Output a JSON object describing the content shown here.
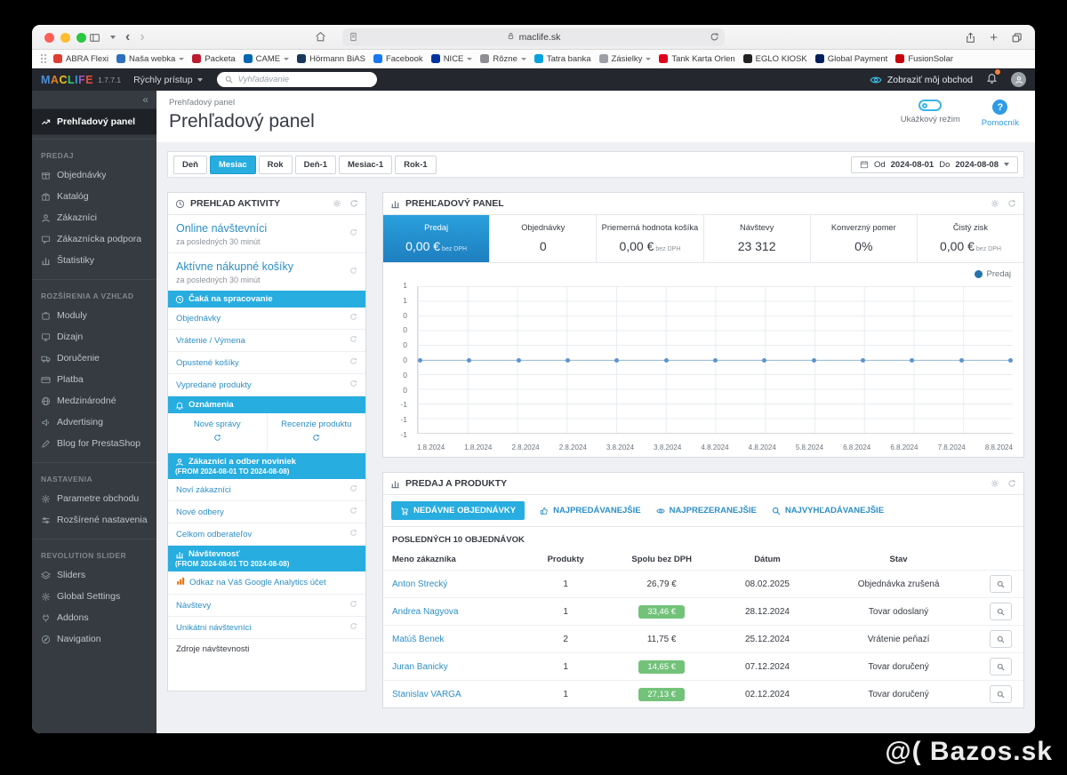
{
  "colors": {
    "accent": "#27ade0",
    "link": "#2d8fc6",
    "success": "#72c279",
    "kpi_active": "#1e7fc0",
    "sidebar_bg": "#363a41"
  },
  "browser": {
    "address": "maclife.sk",
    "bookmarks": [
      {
        "label": "ABRA Flexi"
      },
      {
        "label": "Naša webka"
      },
      {
        "label": "Packeta"
      },
      {
        "label": "CAME"
      },
      {
        "label": "Hörmann BiAS"
      },
      {
        "label": "Facebook"
      },
      {
        "label": "NICE"
      },
      {
        "label": "Rôzne"
      },
      {
        "label": "Tatra banka"
      },
      {
        "label": "Zásielky"
      },
      {
        "label": "Tank Karta Orlen"
      },
      {
        "label": "EGLO KIOSK"
      },
      {
        "label": "Global Payment"
      },
      {
        "label": "FusionSolar"
      }
    ]
  },
  "admin_bar": {
    "logo_letters": [
      {
        "ch": "M",
        "color": "#4a90d9"
      },
      {
        "ch": "A",
        "color": "#e67e22"
      },
      {
        "ch": "C",
        "color": "#f1c40f"
      },
      {
        "ch": "L",
        "color": "#2ecc71"
      },
      {
        "ch": "I",
        "color": "#3498db"
      },
      {
        "ch": "F",
        "color": "#9b59b6"
      },
      {
        "ch": "E",
        "color": "#e74c3c"
      }
    ],
    "version": "1.7.7.1",
    "quick_access": "Rýchly prístup",
    "search_placeholder": "Vyhľadávanie",
    "view_shop": "Zobraziť môj obchod"
  },
  "sidebar": {
    "collapse": "«",
    "active": "Prehľadový panel",
    "sections": [
      {
        "title": "PREDAJ",
        "items": [
          "Objednávky",
          "Katalóg",
          "Zákazníci",
          "Zákaznícka podpora",
          "Štatistiky"
        ]
      },
      {
        "title": "ROZŠÍRENIA A VZHĽAD",
        "items": [
          "Moduly",
          "Dizajn",
          "Doručenie",
          "Platba",
          "Medzinárodné",
          "Advertising",
          "Blog for PrestaShop"
        ]
      },
      {
        "title": "NASTAVENIA",
        "items": [
          "Parametre obchodu",
          "Rozšírené nastavenia"
        ]
      },
      {
        "title": "REVOLUTION SLIDER",
        "items": [
          "Sliders",
          "Global Settings",
          "Addons",
          "Navigation"
        ]
      }
    ]
  },
  "page": {
    "breadcrumb": "Prehľadový panel",
    "title": "Prehľadový panel",
    "demo_mode": "Ukážkový režim",
    "help": "Pomocník",
    "help_glyph": "?"
  },
  "toolbar": {
    "buttons": [
      "Deň",
      "Mesiac",
      "Rok",
      "Deň-1",
      "Mesiac-1",
      "Rok-1"
    ],
    "active": "Mesiac",
    "date_range": {
      "from_label": "Od",
      "from": "2024-08-01",
      "to_label": "Do",
      "to": "2024-08-08"
    }
  },
  "activity": {
    "title": "PREHĽAD AKTIVITY",
    "online": {
      "label": "Online návštevníci",
      "sub": "za posledných 30 minút"
    },
    "carts": {
      "label": "Aktívne nákupné košíky",
      "sub": "za posledných 30 minút"
    },
    "pending": {
      "title": "Čaká na spracovanie",
      "items": [
        "Objednávky",
        "Vrátenie / Výmena",
        "Opustené košíky",
        "Vypredané produkty"
      ]
    },
    "notifications": {
      "title": "Oznámenia",
      "cols": [
        "Nové správy",
        "Recenzie produktu"
      ]
    },
    "customers": {
      "title": "Zákazníci a odber noviniek",
      "range": "(FROM 2024-08-01 TO 2024-08-08)",
      "items": [
        "Noví zákazníci",
        "Nové odbery",
        "Celkom odberateľov"
      ]
    },
    "traffic": {
      "title": "Návštevnosť",
      "range": "(FROM 2024-08-01 TO 2024-08-08)",
      "ga_link": "Odkaz na Váš Google Analytics účet",
      "items": [
        "Návštevy",
        "Unikátni návštevníci"
      ],
      "footer": "Zdroje návštevnosti"
    }
  },
  "dashboard_panel": {
    "title": "PREHĽADOVÝ PANEL",
    "kpis": [
      {
        "label": "Predaj",
        "value": "0,00 €",
        "suffix": "bez DPH"
      },
      {
        "label": "Objednávky",
        "value": "0",
        "suffix": ""
      },
      {
        "label": "Priemerná hodnota košíka",
        "value": "0,00 €",
        "suffix": "bez DPH"
      },
      {
        "label": "Návštevy",
        "value": "23 312",
        "suffix": ""
      },
      {
        "label": "Konverzný pomer",
        "value": "0%",
        "suffix": ""
      },
      {
        "label": "Čistý zisk",
        "value": "0,00 €",
        "suffix": "bez DPH"
      }
    ],
    "legend": "Predaj"
  },
  "chart_data": {
    "type": "line",
    "title": "Predaj",
    "series": [
      {
        "name": "Predaj",
        "values": [
          0,
          0,
          0,
          0,
          0,
          0,
          0,
          0,
          0,
          0,
          0,
          0,
          0
        ]
      }
    ],
    "x_labels": [
      "1.8.2024",
      "1.8.2024",
      "2.8.2024",
      "2.8.2024",
      "3.8.2024",
      "3.8.2024",
      "4.8.2024",
      "4.8.2024",
      "5.8.2024",
      "6.8.2024",
      "6.8.2024",
      "7.8.2024",
      "8.8.2024"
    ],
    "ytick_labels": [
      "1",
      "1",
      "0",
      "0",
      "0",
      "0",
      "0",
      "0",
      "-1",
      "-1",
      "-1"
    ],
    "ylim": [
      -1,
      1
    ],
    "grid": true,
    "legend_position": "top-right"
  },
  "sales_panel": {
    "title": "PREDAJ A PRODUKTY",
    "tabs": [
      "NEDÁVNE OBJEDNÁVKY",
      "NAJPREDÁVANEJŠIE",
      "NAJPREZERANEJŠIE",
      "NAJVYHĽADÁVANEJŠIE"
    ],
    "active_tab": "NEDÁVNE OBJEDNÁVKY",
    "subtitle": "POSLEDNÝCH 10 OBJEDNÁVOK",
    "columns": [
      "Meno zákazníka",
      "Produkty",
      "Spolu bez DPH",
      "Dátum",
      "Stav"
    ],
    "rows": [
      {
        "name": "Anton Strecký",
        "products": "1",
        "total": "26,79 €",
        "badge": false,
        "date": "08.02.2025",
        "status": "Objednávka zrušená"
      },
      {
        "name": "Andrea Nagyova",
        "products": "1",
        "total": "33,46 €",
        "badge": true,
        "date": "28.12.2024",
        "status": "Tovar odoslaný"
      },
      {
        "name": "Matúš Benek",
        "products": "2",
        "total": "11,75 €",
        "badge": false,
        "date": "25.12.2024",
        "status": "Vrátenie peňazí"
      },
      {
        "name": "Juran Banicky",
        "products": "1",
        "total": "14,65 €",
        "badge": true,
        "date": "07.12.2024",
        "status": "Tovar doručený"
      },
      {
        "name": "Stanislav VARGA",
        "products": "1",
        "total": "27,13 €",
        "badge": true,
        "date": "02.12.2024",
        "status": "Tovar doručený"
      }
    ]
  },
  "watermark": {
    "text": "@( Bazos.sk"
  }
}
